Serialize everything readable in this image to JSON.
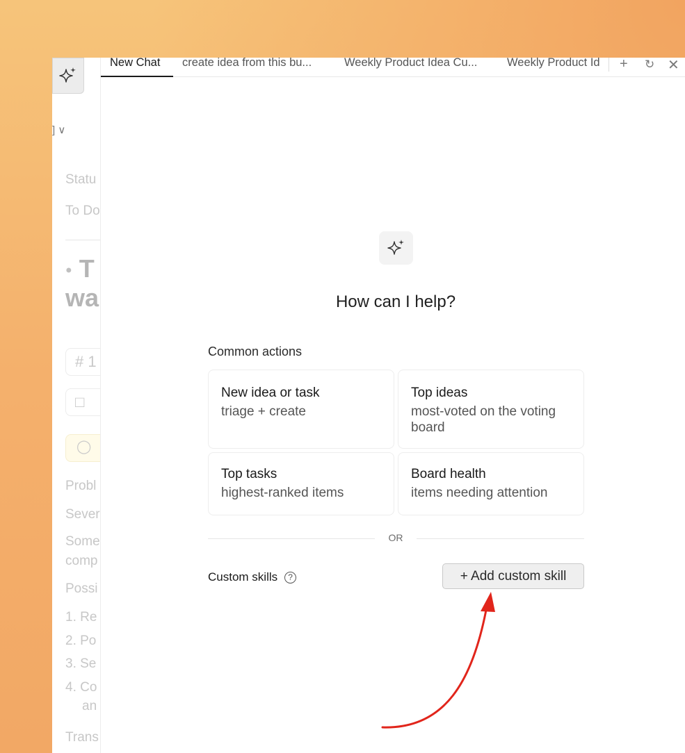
{
  "tabs": [
    {
      "label": "New Chat",
      "active": true
    },
    {
      "label": "create idea from this bu...",
      "active": false
    },
    {
      "label": "Weekly Product Idea Cu...",
      "active": false
    },
    {
      "label": "Weekly Product Id",
      "active": false
    }
  ],
  "tab_actions": {
    "new_icon": "plus-icon",
    "history_icon": "history-icon",
    "close_icon": "close-icon"
  },
  "left_panel": {
    "dropdown_icon": "chevron-down-icon",
    "status_label": "Statu",
    "status_value": "To Do",
    "title_line1": "T",
    "title_line2": "wa",
    "hash_field": "# 1",
    "problem_label": "Probl",
    "severity_label": "Sever",
    "some_line1": "Some",
    "some_line2": "comp",
    "possible_label": "Possi",
    "list": [
      "1. Re",
      "2. Po",
      "3. Se",
      "4. Co",
      "an"
    ],
    "trans_label": "Trans"
  },
  "hero": {
    "icon": "sparkle-icon",
    "title": "How can I help?"
  },
  "common_actions": {
    "label": "Common actions",
    "cards": [
      {
        "title": "New idea or task",
        "subtitle": "triage + create"
      },
      {
        "title": "Top ideas",
        "subtitle": "most-voted on the voting board"
      },
      {
        "title": "Top tasks",
        "subtitle": "highest-ranked items"
      },
      {
        "title": "Board health",
        "subtitle": "items needing attention"
      }
    ]
  },
  "divider": {
    "text": "OR"
  },
  "custom_skills": {
    "label": "Custom skills",
    "help_icon": "?",
    "add_button": "+ Add custom skill"
  },
  "colors": {
    "annotation_arrow": "#e1251b",
    "background": "#f4b06c"
  }
}
